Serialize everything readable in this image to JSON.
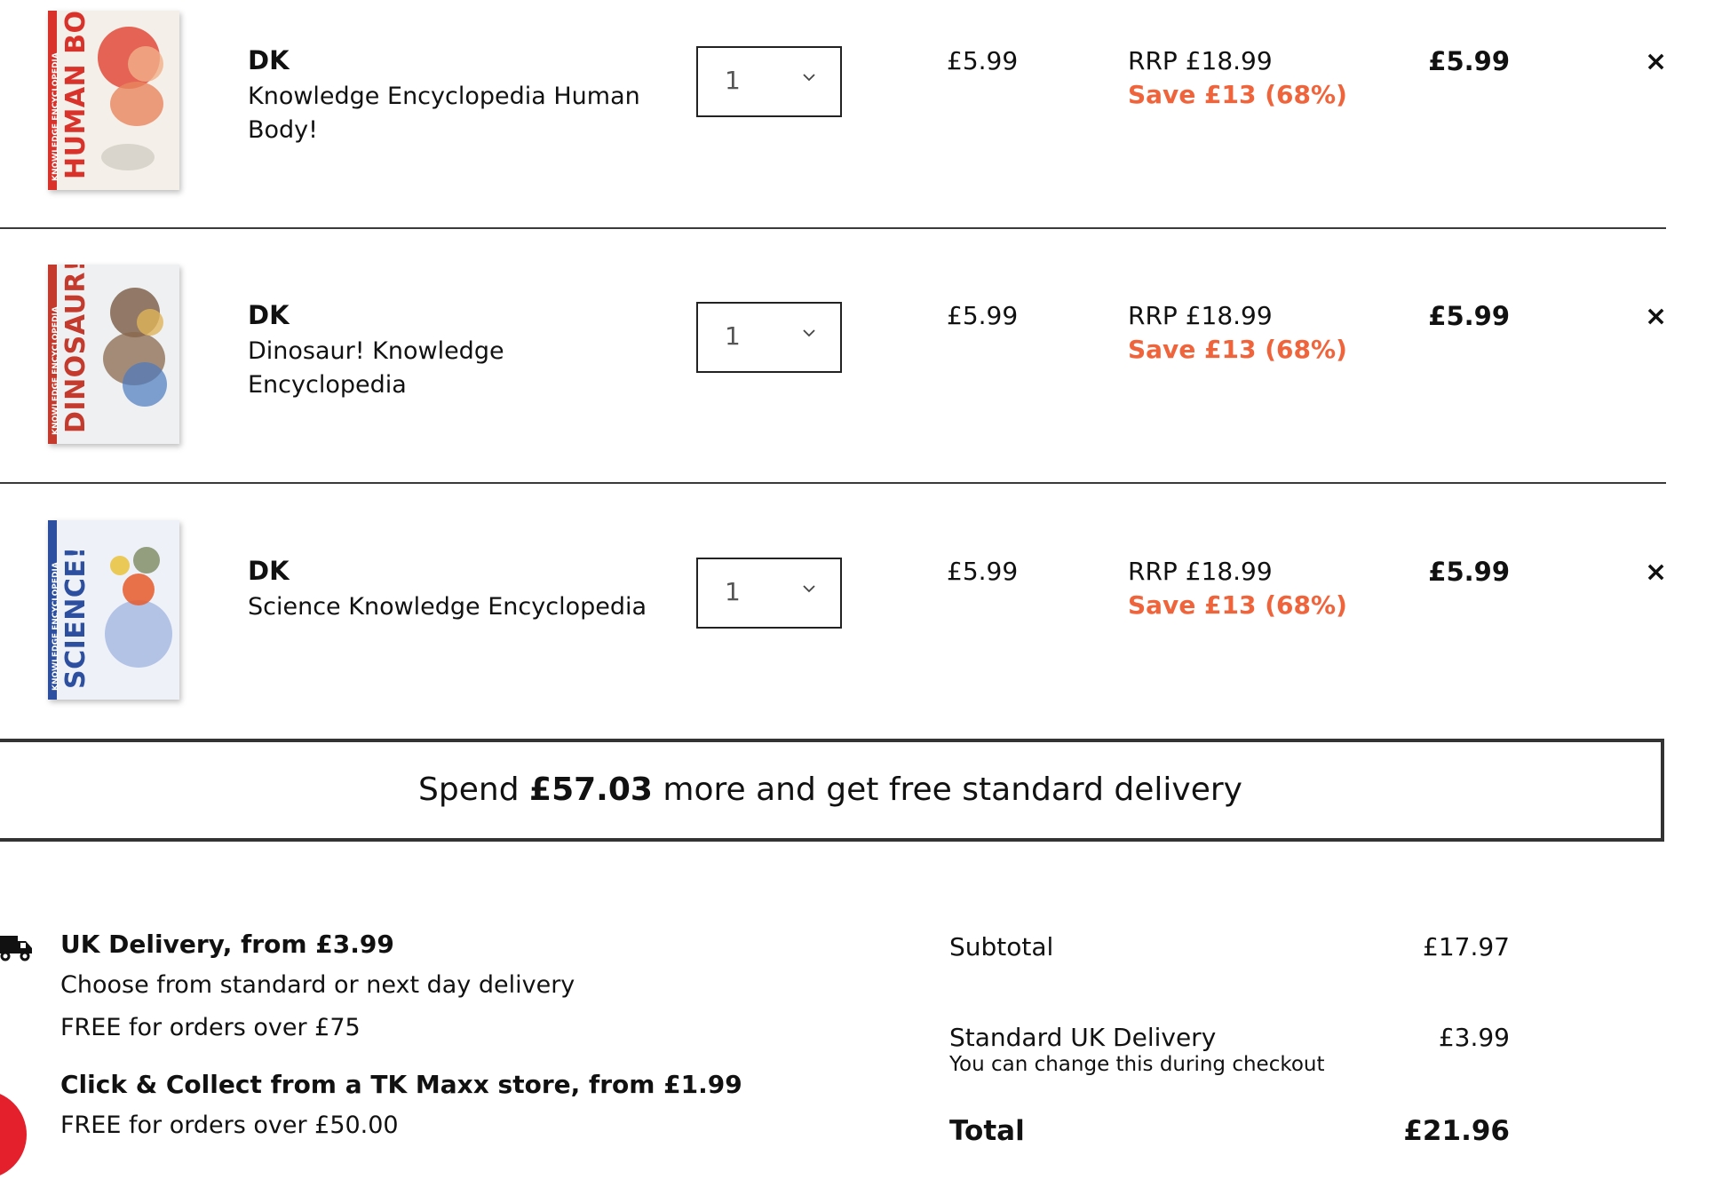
{
  "colors": {
    "save_accent": "#f0643c",
    "border_dark": "#333333",
    "badge_red": "#e4202c"
  },
  "items": [
    {
      "brand": "DK",
      "name": "Knowledge Encyclopedia Human Body!",
      "cover_title": "HUMAN BODY!",
      "cover_sub": "KNOWLEDGE ENCYCLOPEDIA",
      "quantity": "1",
      "unit_price": "£5.99",
      "rrp": "RRP £18.99",
      "save": "Save £13 (68%)",
      "line_total": "£5.99",
      "remove_label": "×"
    },
    {
      "brand": "DK",
      "name": "Dinosaur! Knowledge Encyclopedia",
      "cover_title": "DINOSAUR!",
      "cover_sub": "KNOWLEDGE ENCYCLOPEDIA",
      "quantity": "1",
      "unit_price": "£5.99",
      "rrp": "RRP £18.99",
      "save": "Save £13 (68%)",
      "line_total": "£5.99",
      "remove_label": "×"
    },
    {
      "brand": "DK",
      "name": "Science Knowledge Encyclopedia",
      "cover_title": "SCIENCE!",
      "cover_sub": "KNOWLEDGE ENCYCLOPEDIA",
      "quantity": "1",
      "unit_price": "£5.99",
      "rrp": "RRP £18.99",
      "save": "Save £13 (68%)",
      "line_total": "£5.99",
      "remove_label": "×"
    }
  ],
  "free_delivery_banner": {
    "prefix": "Spend",
    "amount": "£57.03",
    "suffix": "more and get free standard delivery"
  },
  "delivery_info": {
    "uk_title": "UK Delivery, from £3.99",
    "uk_line1": "Choose from standard or next day delivery",
    "uk_line2": "FREE for orders over £75",
    "cc_title": "Click & Collect from a TK Maxx store, from £1.99",
    "cc_line1": "FREE for orders over £50.00"
  },
  "summary": {
    "subtotal_label": "Subtotal",
    "subtotal_value": "£17.97",
    "delivery_label": "Standard UK Delivery",
    "delivery_value": "£3.99",
    "delivery_note": "You can change this during checkout",
    "total_label": "Total",
    "total_value": "£21.96"
  }
}
